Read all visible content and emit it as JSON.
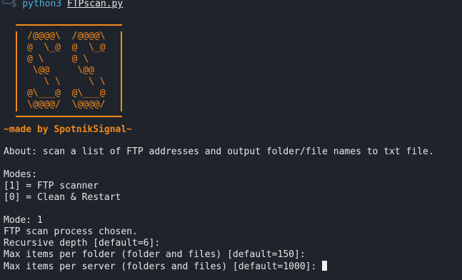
{
  "prompt": {
    "tree": "└─",
    "symbol": "$",
    "command": "python3",
    "argument": "FTPscan.py"
  },
  "banner": {
    "art_lines": [
      "/@@@@\\  /@@@@\\",
      "@  \\_@  @  \\_@",
      "@ \\     @ \\",
      " \\@@     \\@@",
      "   \\ \\     \\ \\",
      "@\\___@  @\\___@",
      "\\@@@@/  \\@@@@/"
    ],
    "credit": "~made by SpotnikSignal~",
    "color": "#f08a1e"
  },
  "output": {
    "about": "About: scan a list of FTP addresses and output folder/file names to txt file.",
    "modes_heading": "Modes:",
    "modes": [
      "[1] = FTP scanner",
      "[0] = Clean & Restart"
    ],
    "mode_selected": "Mode: 1",
    "chosen": "FTP scan process chosen.",
    "prompts": [
      "Recursive depth [default=6]:",
      "Max items per folder (folder and files) [default=150]:",
      "Max items per server (folders and files) [default=1000]: "
    ]
  }
}
